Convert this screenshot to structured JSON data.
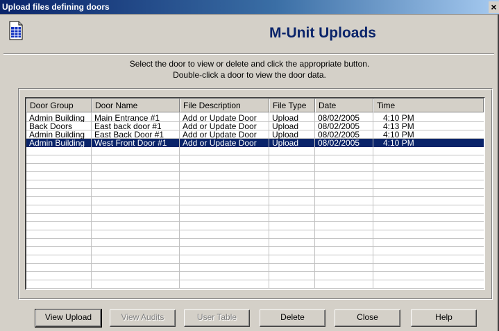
{
  "window": {
    "title": "Upload files defining doors",
    "close": "×"
  },
  "header": {
    "title": "M-Unit Uploads",
    "icon": "document-icon"
  },
  "instructions": {
    "line1": "Select the door to view or delete and click the appropriate button.",
    "line2": "Double-click a door to view the door data."
  },
  "table": {
    "columns": [
      "Door Group",
      "Door Name",
      "File Description",
      "File Type",
      "Date",
      "Time"
    ],
    "rows": [
      [
        "Admin Building",
        "Main Entrance #1",
        "Add or Update Door",
        "Upload",
        "08/02/2005",
        "4:10  PM"
      ],
      [
        "Back Doors",
        "East back door #1",
        "Add or Update Door",
        "Upload",
        "08/02/2005",
        "4:13  PM"
      ],
      [
        "Admin Building",
        "East Back Door #1",
        "Add or Update Door",
        "Upload",
        "08/02/2005",
        "4:10  PM"
      ],
      [
        "Admin Building",
        "West Front Door #1",
        "Add or Update Door",
        "Upload",
        "08/02/2005",
        "4:10  PM"
      ]
    ],
    "selected_row": 4
  },
  "buttons": {
    "view_upload": "View Upload",
    "view_audits": "View Audits",
    "user_table": "User Table",
    "delete": "Delete",
    "close": "Close",
    "help": "Help"
  },
  "colors": {
    "title_bar": "#0a246a",
    "heading": "#0a246a",
    "selection": "#0a246a",
    "face": "#d4d0c8"
  }
}
